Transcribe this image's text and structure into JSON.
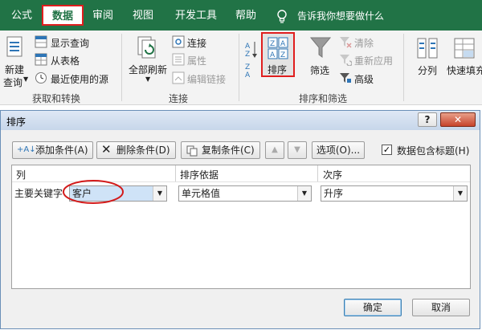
{
  "ribbon_tabs": [
    "公式",
    "数据",
    "审阅",
    "视图",
    "开发工具",
    "帮助"
  ],
  "tell_me": "告诉我你想要做什么",
  "group_get": {
    "new_query_1": "新建",
    "new_query_2": "查询",
    "show_queries": "显示查询",
    "from_table": "从表格",
    "recent_sources": "最近使用的源",
    "label": "获取和转换"
  },
  "group_conn": {
    "refresh_all": "全部刷新",
    "connections": "连接",
    "properties": "属性",
    "edit_links": "编辑链接",
    "label": "连接"
  },
  "group_sort": {
    "sort": "排序",
    "filter": "筛选",
    "clear": "清除",
    "reapply": "重新应用",
    "advanced": "高级",
    "label": "排序和筛选"
  },
  "group_tools": {
    "split": "分列",
    "flash_fill": "快速填充"
  },
  "dialog": {
    "title": "排序",
    "add_level": "添加条件(A)",
    "delete_level": "删除条件(D)",
    "copy_level": "复制条件(C)",
    "options": "选项(O)...",
    "has_headers": "数据包含标题(H)",
    "has_headers_checked": true,
    "col_header": "列",
    "sorton_header": "排序依据",
    "order_header": "次序",
    "row_label": "主要关键字",
    "sort_by_value": "客户",
    "sort_on_value": "单元格值",
    "order_value": "升序",
    "ok": "确定",
    "cancel": "取消"
  }
}
